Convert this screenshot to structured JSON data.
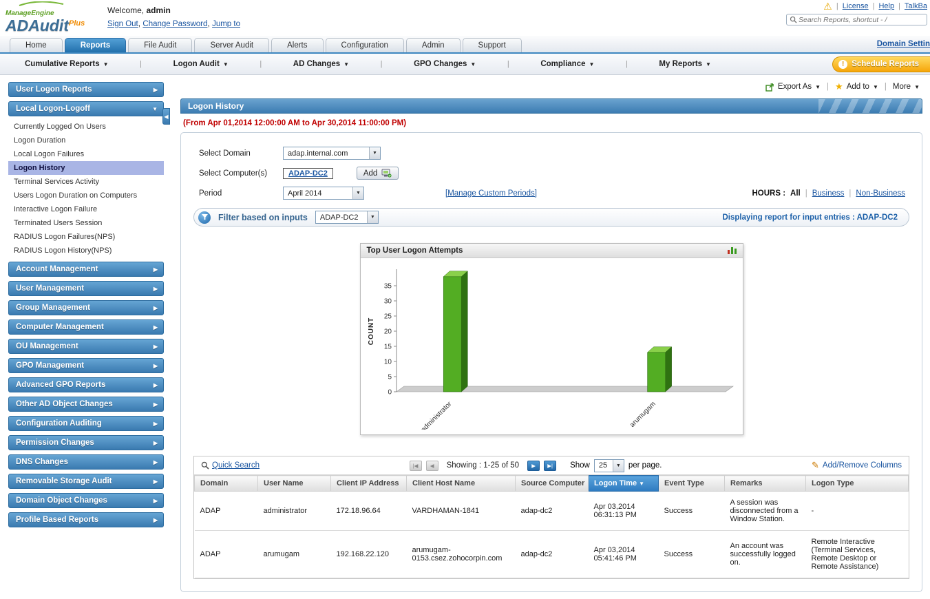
{
  "colors": {
    "accent_blue": "#2270ac",
    "link_blue": "#1a55a0",
    "red_text": "#c00000",
    "bar_green": "#53ad23",
    "orange_button": "#f6a50a",
    "selected_item": "#a9b5e5"
  },
  "header": {
    "logo": {
      "brand": "ManageEngine",
      "product": "ADAudit",
      "plus": "Plus"
    },
    "welcome_prefix": "Welcome,",
    "welcome_user": "admin",
    "links": [
      "Sign Out",
      "Change Password",
      "Jump to"
    ],
    "top_links": [
      "License",
      "Help",
      "TalkBa"
    ],
    "search_placeholder": "Search Reports, shortcut - /"
  },
  "tabs": {
    "items": [
      "Home",
      "Reports",
      "File Audit",
      "Server Audit",
      "Alerts",
      "Configuration",
      "Admin",
      "Support"
    ],
    "active": "Reports",
    "right_link": "Domain Settin"
  },
  "subnav": {
    "items": [
      "Cumulative Reports",
      "Logon Audit",
      "AD Changes",
      "GPO Changes",
      "Compliance",
      "My Reports"
    ],
    "schedule_button": "Schedule Reports"
  },
  "sidebar": {
    "sections": [
      {
        "label": "User Logon Reports",
        "state": "collapsed"
      },
      {
        "label": "Local Logon-Logoff",
        "state": "expanded",
        "selected": "Logon History",
        "items": [
          "Currently Logged On Users",
          "Logon Duration",
          "Local Logon Failures",
          "Logon History",
          "Terminal Services Activity",
          "Users Logon Duration on Computers",
          "Interactive Logon Failure",
          "Terminated Users Session",
          "RADIUS Logon Failures(NPS)",
          "RADIUS Logon History(NPS)"
        ]
      },
      {
        "label": "Account Management",
        "state": "collapsed"
      },
      {
        "label": "User Management",
        "state": "collapsed"
      },
      {
        "label": "Group Management",
        "state": "collapsed"
      },
      {
        "label": "Computer Management",
        "state": "collapsed"
      },
      {
        "label": "OU Management",
        "state": "collapsed"
      },
      {
        "label": "GPO Management",
        "state": "collapsed"
      },
      {
        "label": "Advanced GPO Reports",
        "state": "collapsed"
      },
      {
        "label": "Other AD Object Changes",
        "state": "collapsed"
      },
      {
        "label": "Configuration Auditing",
        "state": "collapsed"
      },
      {
        "label": "Permission Changes",
        "state": "collapsed"
      },
      {
        "label": "DNS Changes",
        "state": "collapsed"
      },
      {
        "label": "Removable Storage Audit",
        "state": "collapsed"
      },
      {
        "label": "Domain Object Changes",
        "state": "collapsed"
      },
      {
        "label": "Profile Based Reports",
        "state": "collapsed"
      }
    ]
  },
  "actions": {
    "export_as": "Export As",
    "add_to": "Add to",
    "more": "More"
  },
  "report": {
    "title": "Logon History",
    "date_range": "(From Apr 01,2014 12:00:00 AM to Apr 30,2014 11:00:00 PM)",
    "form": {
      "domain_label": "Select Domain",
      "domain_value": "adap.internal.com",
      "computers_label": "Select Computer(s)",
      "computers_value": "ADAP-DC2",
      "add_button": "Add",
      "period_label": "Period",
      "period_value": "April 2014",
      "manage_custom_periods": "[Manage Custom Periods]",
      "hours_label": "HOURS :",
      "hours_all": "All",
      "hours_business": "Business",
      "hours_nonbusiness": "Non-Business"
    },
    "filter": {
      "label": "Filter based on inputs",
      "value": "ADAP-DC2",
      "displaying": "Displaying report for input entries : ADAP-DC2"
    }
  },
  "chart_data": {
    "type": "bar",
    "title": "Top User Logon Attempts",
    "categories": [
      "administrator",
      "arumugam"
    ],
    "values": [
      38,
      13
    ],
    "xlabel": "",
    "ylabel": "COUNT",
    "yticks": [
      0,
      5,
      10,
      15,
      20,
      25,
      30,
      35
    ],
    "ylim": [
      0,
      40
    ],
    "grid": false,
    "legend": "none",
    "bar_color": "#53ad23"
  },
  "table": {
    "quick_search": "Quick Search",
    "showing": "Showing : 1-25 of 50",
    "show_label": "Show",
    "page_size": "25",
    "per_page": "per page.",
    "add_remove_columns": "Add/Remove Columns",
    "columns": [
      "Domain",
      "User Name",
      "Client IP Address",
      "Client Host Name",
      "Source Computer",
      "Logon Time",
      "Event Type",
      "Remarks",
      "Logon Type"
    ],
    "sorted_column": "Logon Time",
    "rows": [
      {
        "cells": [
          "ADAP",
          "administrator",
          "172.18.96.64",
          "VARDHAMAN-1841",
          "adap-dc2",
          "Apr 03,2014 06:31:13 PM",
          "Success",
          "A session was disconnected from a Window Station.",
          "-"
        ]
      },
      {
        "cells": [
          "ADAP",
          "arumugam",
          "192.168.22.120",
          "arumugam-0153.csez.zohocorpin.com",
          "adap-dc2",
          "Apr 03,2014 05:41:46 PM",
          "Success",
          "An account was successfully logged on.",
          "Remote Interactive (Terminal Services, Remote Desktop or Remote Assistance)"
        ]
      }
    ]
  }
}
